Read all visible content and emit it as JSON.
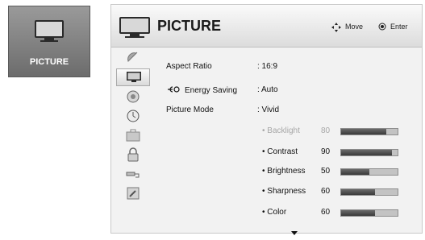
{
  "side_tile": {
    "label": "PICTURE",
    "icon": "tv-icon"
  },
  "header": {
    "title": "PICTURE",
    "move_label": "Move",
    "enter_label": "Enter"
  },
  "categories": [
    {
      "icon": "satellite-icon"
    },
    {
      "icon": "tv-icon",
      "selected": true
    },
    {
      "icon": "speaker-icon"
    },
    {
      "icon": "clock-icon"
    },
    {
      "icon": "briefcase-icon"
    },
    {
      "icon": "lock-icon"
    },
    {
      "icon": "input-plug-icon"
    },
    {
      "icon": "support-icon"
    }
  ],
  "settings": {
    "aspect": {
      "label": "Aspect Ratio",
      "value": ": 16:9"
    },
    "energy": {
      "label": "Energy Saving",
      "value": ": Auto",
      "icon": "energy-saving-icon"
    },
    "mode": {
      "label": "Picture Mode",
      "value": ": Vivid"
    }
  },
  "levels": [
    {
      "label": "• Backlight",
      "value": "80",
      "fraction": 0.8,
      "dimmed": true
    },
    {
      "label": "• Contrast",
      "value": "90",
      "fraction": 0.9
    },
    {
      "label": "• Brightness",
      "value": "50",
      "fraction": 0.5
    },
    {
      "label": "• Sharpness",
      "value": "60",
      "fraction": 0.6
    },
    {
      "label": "• Color",
      "value": "60",
      "fraction": 0.6
    }
  ]
}
